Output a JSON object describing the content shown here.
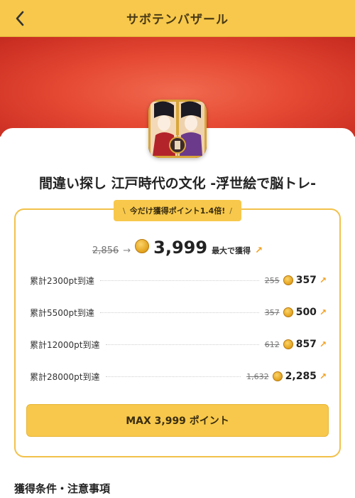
{
  "header": {
    "title": "サボテンバザール"
  },
  "app": {
    "title": "間違い探し 江戸時代の文化 -浮世絵で脳トレ-"
  },
  "promo": {
    "label": "今だけ獲得ポイント1.4倍!",
    "slash_left": "\\",
    "slash_right": "/"
  },
  "summary": {
    "old_value": "2,856",
    "arrow": "→",
    "new_value": "3,999",
    "max_label": "最大で獲得",
    "ext": "↗"
  },
  "rows": [
    {
      "label": "累計2300pt到達",
      "old": "255",
      "value": "357",
      "ext": "↗"
    },
    {
      "label": "累計5500pt到達",
      "old": "357",
      "value": "500",
      "ext": "↗"
    },
    {
      "label": "累計12000pt到達",
      "old": "612",
      "value": "857",
      "ext": "↗"
    },
    {
      "label": "累計28000pt到達",
      "old": "1,632",
      "value": "2,285",
      "ext": "↗"
    }
  ],
  "cta": {
    "label": "MAX 3,999 ポイント"
  },
  "section": {
    "title": "獲得条件・注意事項"
  },
  "colors": {
    "accent": "#f7c84b",
    "banner": "#e64a34",
    "border": "#f2c14a",
    "ext_arrow": "#f0a020"
  },
  "icons": {
    "back": "chevron-left-icon",
    "coin": "coin-icon",
    "ext": "external-link-icon"
  }
}
